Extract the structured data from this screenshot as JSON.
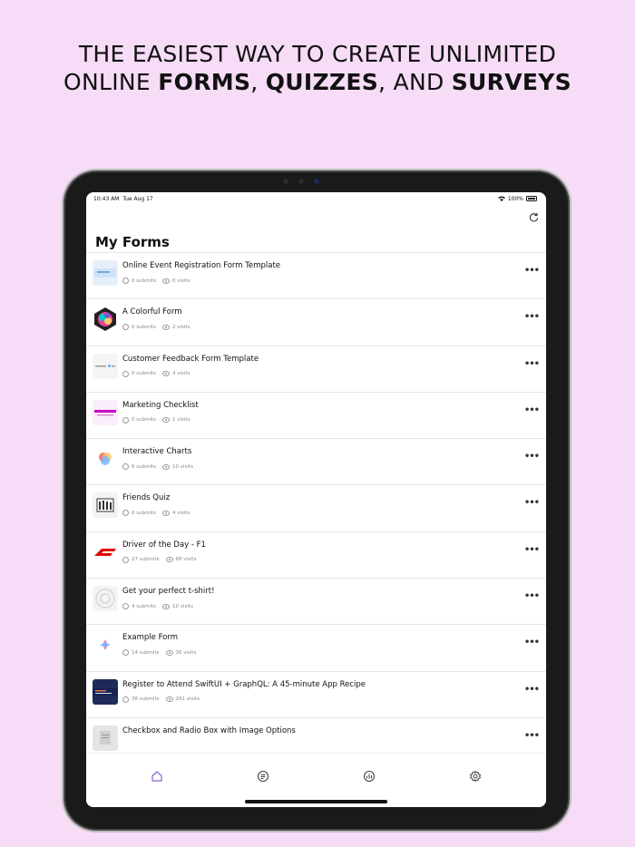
{
  "headline": {
    "line1": "THE EASIEST WAY TO CREATE UNLIMITED",
    "line2_prefix": "ONLINE ",
    "line2_forms": "FORMS",
    "line2_sep1": ", ",
    "line2_quizzes": "QUIZZES",
    "line2_sep2": ", AND ",
    "line2_surveys": "SURVEYS"
  },
  "statusbar": {
    "time": "10:43 AM",
    "date": "Tue Aug 17",
    "battery": "100%"
  },
  "page_title": "My Forms",
  "forms": [
    {
      "title": "Online Event Registration Form Template",
      "submits": "0 submits",
      "visits": "0 visits"
    },
    {
      "title": "A Colorful Form",
      "submits": "0 submits",
      "visits": "2 visits"
    },
    {
      "title": "Customer Feedback Form Template",
      "submits": "0 submits",
      "visits": "4 visits"
    },
    {
      "title": "Marketing Checklist",
      "submits": "0 submits",
      "visits": "1 visits"
    },
    {
      "title": "Interactive Charts",
      "submits": "6 submits",
      "visits": "10 visits"
    },
    {
      "title": "Friends Quiz",
      "submits": "0 submits",
      "visits": "4 visits"
    },
    {
      "title": "Driver of the Day - F1",
      "submits": "27 submits",
      "visits": "68 visits"
    },
    {
      "title": "Get your perfect t-shirt!",
      "submits": "4 submits",
      "visits": "10 visits"
    },
    {
      "title": "Example Form",
      "submits": "14 submits",
      "visits": "36 visits"
    },
    {
      "title": "Register to Attend SwiftUI + GraphQL: A 45-minute App Recipe",
      "submits": "38 submits",
      "visits": "291 visits"
    },
    {
      "title": "Checkbox and Radio Box with Image Options",
      "submits": "",
      "visits": ""
    }
  ],
  "more_glyph": "•••",
  "tabs": [
    "home-icon",
    "forms-icon",
    "analytics-icon",
    "settings-icon"
  ],
  "colors": {
    "background": "#f6dcf6",
    "accent": "#8a63d2"
  }
}
